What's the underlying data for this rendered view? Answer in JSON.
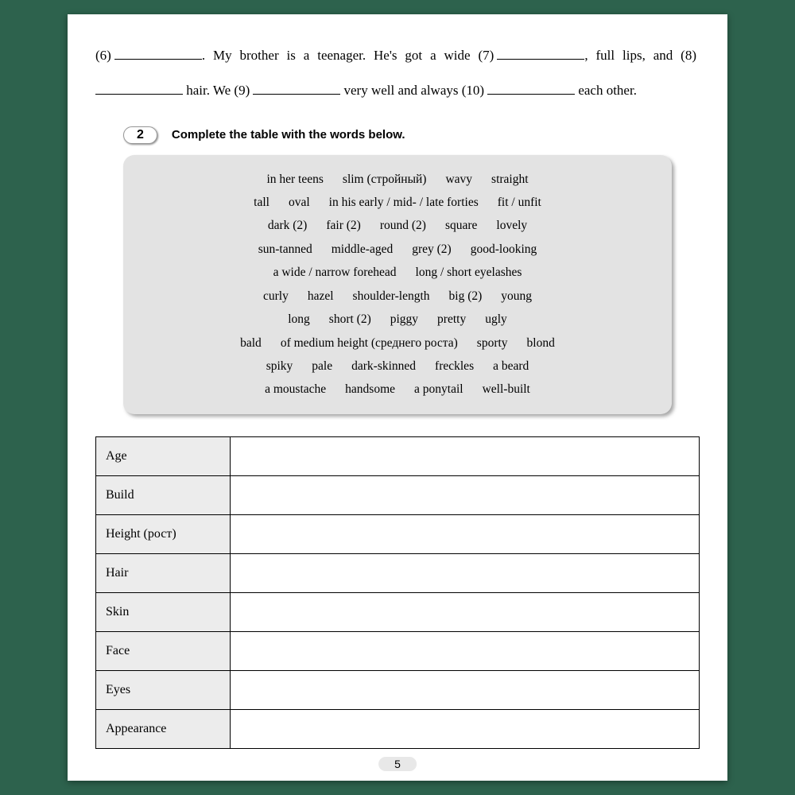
{
  "fill": {
    "p1a": "(6)",
    "p1b": ". My brother is a teenager. He's got a wide (7)",
    "p1c": ",",
    "p2a": "full lips, and (8)",
    "p2b": " hair. We (9)",
    "p2c": " very well and always",
    "p3a": "(10)",
    "p3b": " each other."
  },
  "ex": {
    "num": "2",
    "instr": "Complete the table with the words below."
  },
  "words": [
    "in her teens",
    "slim (стройный)",
    "wavy",
    "straight",
    "tall",
    "oval",
    "in his early / mid- / late forties",
    "fit / unfit",
    "dark (2)",
    "fair (2)",
    "round (2)",
    "square",
    "lovely",
    "sun-tanned",
    "middle-aged",
    "grey (2)",
    "good-looking",
    "a wide / narrow forehead",
    "long / short eyelashes",
    "curly",
    "hazel",
    "shoulder-length",
    "big (2)",
    "young",
    "long",
    "short (2)",
    "piggy",
    "pretty",
    "ugly",
    "bald",
    "of medium height (среднего роста)",
    "sporty",
    "blond",
    "spiky",
    "pale",
    "dark-skinned",
    "freckles",
    "a beard",
    "a moustache",
    "handsome",
    "a ponytail",
    "well-built"
  ],
  "rows": [
    "Age",
    "Build",
    "Height (рост)",
    "Hair",
    "Skin",
    "Face",
    "Eyes",
    "Appearance"
  ],
  "pagenum": "5"
}
